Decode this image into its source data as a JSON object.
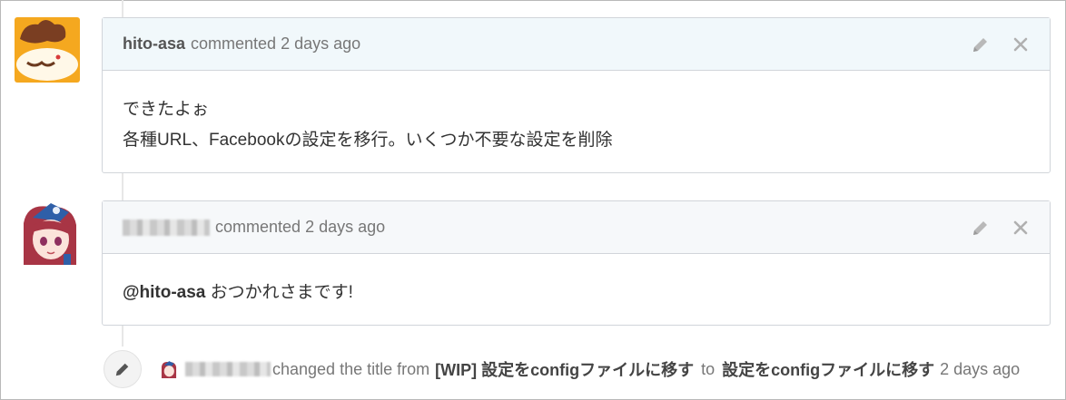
{
  "comments": [
    {
      "author": "hito-asa",
      "action": "commented",
      "time": "2 days ago",
      "body_lines": [
        "できたよぉ",
        "各種URL、Facebookの設定を移行。いくつか不要な設定を削除"
      ]
    },
    {
      "author": "",
      "action": "commented",
      "time": "2 days ago",
      "mention": "@hito-asa",
      "body_text": "おつかれさまです!"
    }
  ],
  "event": {
    "action": "changed the title from",
    "old_title": "[WIP] 設定をconfigファイルに移す",
    "connector": "to",
    "new_title": "設定をconfigファイルに移す",
    "time": "2 days ago"
  },
  "icons": {
    "edit": "pencil-icon",
    "delete": "close-icon"
  },
  "colors": {
    "header_highlight": "#f1f8fb",
    "header_default": "#f6f8fa",
    "border": "#d1d5da"
  }
}
